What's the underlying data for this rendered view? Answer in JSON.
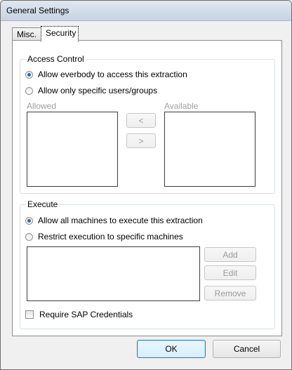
{
  "window": {
    "title": "General Settings"
  },
  "tabs": [
    {
      "label": "Misc.",
      "active": false
    },
    {
      "label": "Security",
      "active": true
    }
  ],
  "access_control": {
    "label": "Access Control",
    "options": [
      {
        "label": "Allow everbody to access this extraction",
        "checked": true
      },
      {
        "label": "Allow only specific users/groups",
        "checked": false
      }
    ],
    "allowed_label": "Allowed",
    "available_label": "Available",
    "move_left_label": "<",
    "move_right_label": ">"
  },
  "execute": {
    "label": "Execute",
    "options": [
      {
        "label": "Allow all machines to execute this extraction",
        "checked": true
      },
      {
        "label": "Restrict execution to specific machines",
        "checked": false
      }
    ],
    "add_label": "Add",
    "edit_label": "Edit",
    "remove_label": "Remove",
    "require_sap_credentials": {
      "label": "Require SAP Credentials",
      "checked": false
    }
  },
  "footer": {
    "ok_label": "OK",
    "cancel_label": "Cancel"
  }
}
